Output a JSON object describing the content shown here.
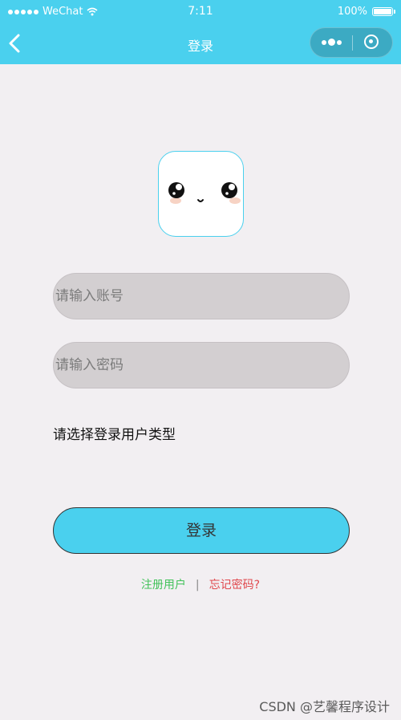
{
  "status_bar": {
    "carrier": "WeChat",
    "time": "7:11",
    "battery": "100%"
  },
  "nav": {
    "title": "登录",
    "back_icon": "chevron-left-icon",
    "more_icon": "more-dots-icon",
    "close_icon": "target-close-icon"
  },
  "form": {
    "account_placeholder": "请输入账号",
    "password_placeholder": "请输入密码",
    "user_type_label": "请选择登录用户类型",
    "login_button": "登录"
  },
  "links": {
    "register": "注册用户",
    "separator": "|",
    "forgot": "忘记密码?"
  },
  "watermark": "CSDN @艺馨程序设计",
  "colors": {
    "accent": "#4ad0ee",
    "background": "#f2eff2",
    "input_bg": "#d3cfd1",
    "register": "#42c25a",
    "forgot": "#e0474c"
  }
}
